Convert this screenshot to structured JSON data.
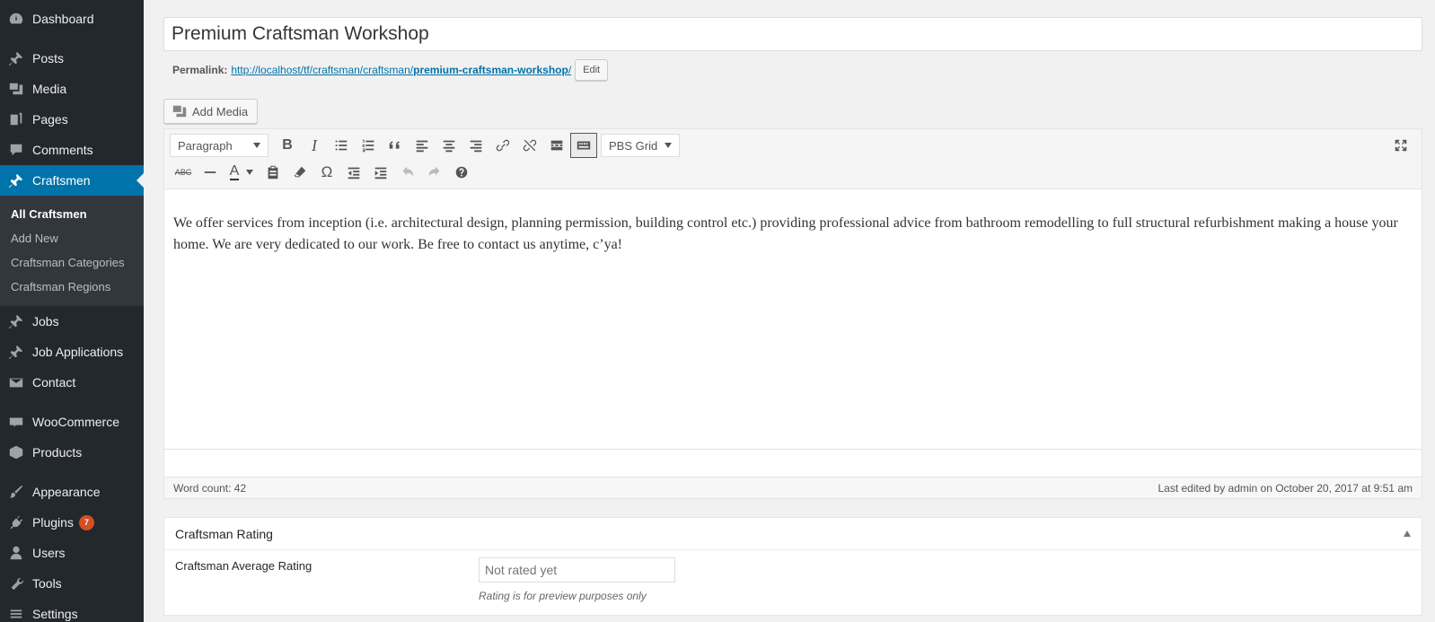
{
  "sidebar": {
    "dashboard": "Dashboard",
    "posts": "Posts",
    "media": "Media",
    "pages": "Pages",
    "comments": "Comments",
    "craftsmen": "Craftsmen",
    "submenu": [
      "All Craftsmen",
      "Add New",
      "Craftsman Categories",
      "Craftsman Regions"
    ],
    "jobs": "Jobs",
    "job_applications": "Job Applications",
    "contact": "Contact",
    "woocommerce": "WooCommerce",
    "products": "Products",
    "appearance": "Appearance",
    "plugins": "Plugins",
    "plugins_badge": "7",
    "users": "Users",
    "tools": "Tools",
    "settings": "Settings"
  },
  "post": {
    "title": "Premium Craftsman Workshop",
    "permalink_label": "Permalink:",
    "permalink_base": "http://localhost/tf/craftsman/craftsman/",
    "permalink_slug": "premium-craftsman-workshop",
    "permalink_trail": "/",
    "edit_label": "Edit",
    "add_media_label": "Add Media"
  },
  "editor": {
    "format_select": "Paragraph",
    "grid_select": "PBS Grid",
    "content": "We offer services from inception (i.e. architectural design, planning permission, building control etc.) providing professional advice from bathroom remodelling to full structural refurbishment making a house your home. We are very dedicated to our work. Be free to contact us anytime, c’ya!",
    "word_count": "Word count: 42",
    "last_edited": "Last edited by admin on October 20, 2017 at 9:51 am"
  },
  "metabox": {
    "title": "Craftsman Rating",
    "field_label": "Craftsman Average Rating",
    "field_placeholder": "Not rated yet",
    "note": "Rating is for preview purposes only"
  },
  "colors": {
    "sidebar_bg": "#23282d",
    "accent": "#0073aa",
    "badge": "#d54e21"
  }
}
